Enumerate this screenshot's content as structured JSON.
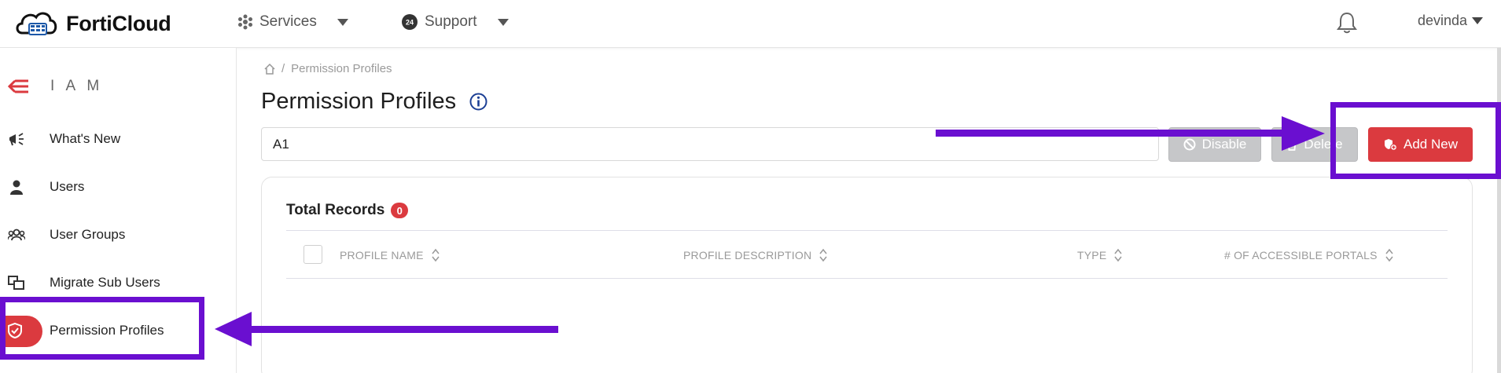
{
  "colors": {
    "accent": "#db3a3f",
    "annotation": "#6a0fd0",
    "disabled": "#c6c7c9"
  },
  "topbar": {
    "brand": "FortiCloud",
    "services_label": "Services",
    "support_label": "Support",
    "username": "devinda"
  },
  "sidebar": {
    "section_label": "I A M",
    "items": [
      {
        "label": "What's New",
        "icon": "megaphone-icon"
      },
      {
        "label": "Users",
        "icon": "user-icon"
      },
      {
        "label": "User Groups",
        "icon": "user-group-icon"
      },
      {
        "label": "Migrate Sub Users",
        "icon": "migrate-icon"
      },
      {
        "label": "Permission Profiles",
        "icon": "shield-icon",
        "active": true
      }
    ]
  },
  "breadcrumb": {
    "current": "Permission Profiles"
  },
  "page": {
    "title": "Permission Profiles"
  },
  "search": {
    "value": "A1"
  },
  "toolbar": {
    "disable_label": "Disable",
    "delete_label": "Delete",
    "add_label": "Add New"
  },
  "table": {
    "total_label": "Total Records",
    "total_count": "0",
    "columns": [
      "PROFILE NAME",
      "PROFILE DESCRIPTION",
      "TYPE",
      "# OF ACCESSIBLE PORTALS"
    ],
    "rows": []
  }
}
